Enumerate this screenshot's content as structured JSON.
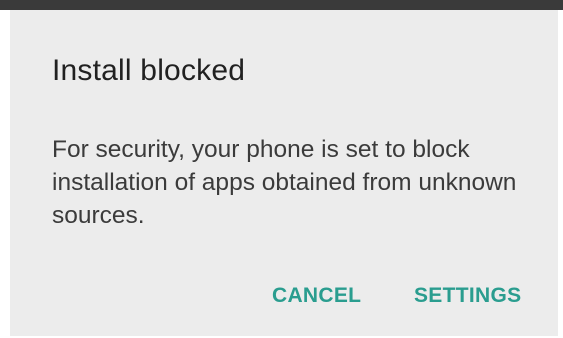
{
  "dialog": {
    "title": "Install blocked",
    "message": "For security, your phone is set to block installation of apps obtained from unknown sources.",
    "actions": {
      "cancel_label": "CANCEL",
      "settings_label": "SETTINGS"
    }
  },
  "colors": {
    "accent": "#2a9d8f",
    "dialog_background": "#ececec",
    "status_strip": "#3a3a3a"
  }
}
